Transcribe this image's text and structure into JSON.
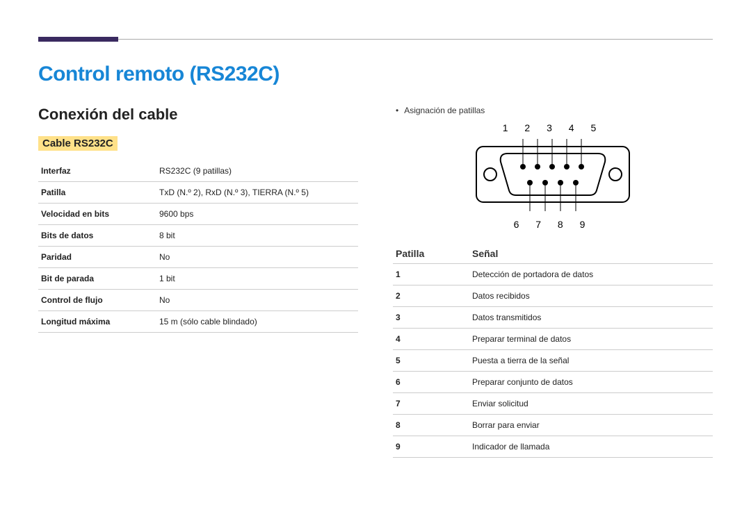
{
  "title": "Control remoto (RS232C)",
  "section": "Conexión del cable",
  "subsection": "Cable RS232C",
  "spec": {
    "rows": [
      {
        "label": "Interfaz",
        "value": "RS232C (9 patillas)"
      },
      {
        "label": "Patilla",
        "value": "TxD (N.º 2), RxD (N.º 3), TIERRA (N.º 5)"
      },
      {
        "label": "Velocidad en bits",
        "value": "9600 bps"
      },
      {
        "label": "Bits de datos",
        "value": "8 bit"
      },
      {
        "label": "Paridad",
        "value": "No"
      },
      {
        "label": "Bit de parada",
        "value": "1 bit"
      },
      {
        "label": "Control de flujo",
        "value": "No"
      },
      {
        "label": "Longitud máxima",
        "value": "15 m (sólo cable blindado)"
      }
    ]
  },
  "pin_assignment_label": "Asignación de patillas",
  "top_pins": "1  2  3  4  5",
  "bottom_pins": "6  7  8  9",
  "pin_table": {
    "header_pin": "Patilla",
    "header_signal": "Señal",
    "rows": [
      {
        "n": "1",
        "s": "Detección de portadora de datos"
      },
      {
        "n": "2",
        "s": "Datos recibidos"
      },
      {
        "n": "3",
        "s": "Datos transmitidos"
      },
      {
        "n": "4",
        "s": "Preparar terminal de datos"
      },
      {
        "n": "5",
        "s": "Puesta a tierra de la señal"
      },
      {
        "n": "6",
        "s": "Preparar conjunto de datos"
      },
      {
        "n": "7",
        "s": "Enviar solicitud"
      },
      {
        "n": "8",
        "s": "Borrar para enviar"
      },
      {
        "n": "9",
        "s": "Indicador de llamada"
      }
    ]
  }
}
